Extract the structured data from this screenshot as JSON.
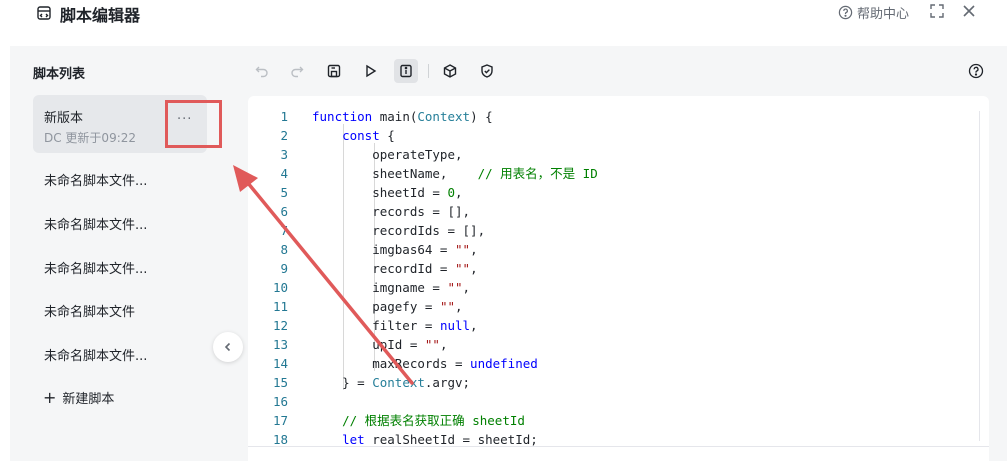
{
  "header": {
    "title": "脚本编辑器",
    "help_label": "帮助中心"
  },
  "sidebar": {
    "title": "脚本列表",
    "items": [
      {
        "name": "新版本",
        "meta": "DC 更新于09:22",
        "more": "···"
      },
      {
        "name": "未命名脚本文件..."
      },
      {
        "name": "未命名脚本文件..."
      },
      {
        "name": "未命名脚本文件..."
      },
      {
        "name": "未命名脚本文件"
      },
      {
        "name": "未命名脚本文件..."
      }
    ],
    "new_label": "新建脚本"
  },
  "toolbar": {
    "icons": [
      "undo-icon",
      "redo-icon",
      "save-icon",
      "run-icon",
      "info-icon",
      "package-icon",
      "shield-icon",
      "help-icon"
    ]
  },
  "editor": {
    "line_numbers": [
      "1",
      "2",
      "3",
      "4",
      "5",
      "6",
      "7",
      "8",
      "9",
      "10",
      "11",
      "12",
      "13",
      "14",
      "15",
      "16",
      "17",
      "18"
    ]
  },
  "colors": {
    "accent_red": "#e05a5a",
    "sidebar_bg": "#f5f6f7",
    "active_item_bg": "#e6e8eb"
  }
}
